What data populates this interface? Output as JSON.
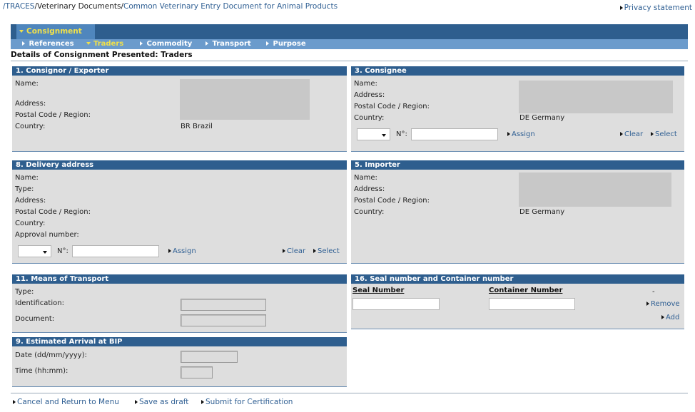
{
  "breadcrumb": {
    "root": "/TRACES",
    "sep1": "/",
    "mid": "Veterinary Documents",
    "sep2": "/",
    "current": "Common Veterinary Entry Document for Animal Products"
  },
  "privacy": "Privacy statement",
  "tabs": {
    "main": "Consignment",
    "sub": [
      "References",
      "Traders",
      "Commodity",
      "Transport",
      "Purpose"
    ],
    "active_sub": "Traders"
  },
  "section_title": "Details of Consignment Presented: Traders",
  "consignor": {
    "title": "1. Consignor / Exporter",
    "name_label": "Name:",
    "address_label": "Address:",
    "postal_label": "Postal Code / Region:",
    "country_label": "Country:",
    "country_value": "BR Brazil"
  },
  "consignee": {
    "title": "3. Consignee",
    "name_label": "Name:",
    "address_label": "Address:",
    "postal_label": "Postal Code / Region:",
    "country_label": "Country:",
    "country_value": "DE Germany",
    "no_label": "N°:",
    "assign": "Assign",
    "clear": "Clear",
    "select": "Select"
  },
  "delivery": {
    "title": "8. Delivery address",
    "name_label": "Name:",
    "type_label": "Type:",
    "address_label": "Address:",
    "postal_label": "Postal Code / Region:",
    "country_label": "Country:",
    "approval_label": "Approval number:",
    "no_label": "N°:",
    "assign": "Assign",
    "clear": "Clear",
    "select": "Select"
  },
  "importer": {
    "title": "5. Importer",
    "name_label": "Name:",
    "address_label": "Address:",
    "postal_label": "Postal Code / Region:",
    "country_label": "Country:",
    "country_value": "DE Germany"
  },
  "transport": {
    "title": "11. Means of Transport",
    "type_label": "Type:",
    "id_label": "Identification:",
    "doc_label": "Document:"
  },
  "seal": {
    "title": "16. Seal number and Container number",
    "seal_label": "Seal Number",
    "container_label": "Container Number",
    "dash": "-",
    "remove": "Remove",
    "add": "Add"
  },
  "arrival": {
    "title": "9. Estimated Arrival at BIP",
    "date_label": "Date (dd/mm/yyyy):",
    "time_label": "Time (hh:mm):"
  },
  "footer": {
    "cancel": "Cancel and Return to Menu",
    "save": "Save as draft",
    "submit": "Submit for Certification"
  }
}
